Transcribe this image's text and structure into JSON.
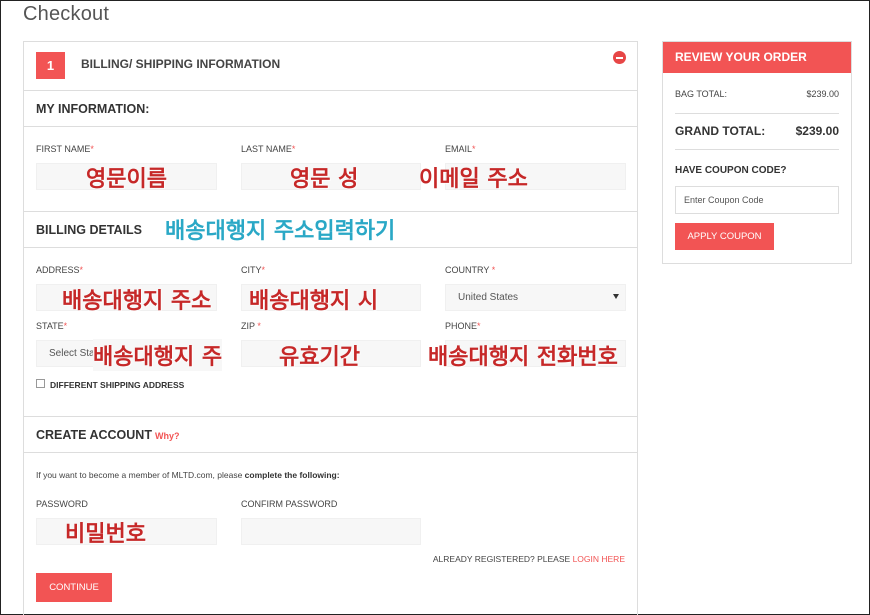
{
  "page": {
    "title": "Checkout"
  },
  "step": {
    "number": "1",
    "title": "BILLING/ SHIPPING INFORMATION"
  },
  "my_info": {
    "heading": "MY INFORMATION:",
    "first_name": {
      "label": "FIRST NAME",
      "req": "*",
      "annotation": "영문이름"
    },
    "last_name": {
      "label": "LAST NAME",
      "req": "*",
      "annotation": "영문 성"
    },
    "email": {
      "label": "EMAIL",
      "req": "*",
      "annotation": "이메일 주소"
    }
  },
  "billing": {
    "heading": "BILLING DETAILS",
    "heading_annotation": "배송대행지 주소입력하기",
    "address": {
      "label": "ADDRESS",
      "req": "*",
      "annotation": "배송대행지 주소"
    },
    "city": {
      "label": "CITY",
      "req": "*",
      "annotation": "배송대행지 시"
    },
    "country": {
      "label": "COUNTRY",
      "req": " *",
      "value": "United States"
    },
    "state": {
      "label": "STATE",
      "req": "*",
      "value": "Select State",
      "annotation": "배송대행지 주"
    },
    "zip": {
      "label": "ZIP",
      "req": " *",
      "annotation": "유효기간"
    },
    "phone": {
      "label": "PHONE",
      "req": "*",
      "annotation": "배송대행지 전화번호"
    },
    "different_shipping": "DIFFERENT SHIPPING ADDRESS"
  },
  "create_account": {
    "heading": "CREATE ACCOUNT",
    "why": "Why?",
    "info_prefix": "If you want to become a member of MLTD.com, please ",
    "info_bold": "complete the following:",
    "password": {
      "label": "PASSWORD",
      "annotation": "비밀번호"
    },
    "confirm_password": {
      "label": "CONFIRM PASSWORD"
    },
    "already_registered": "ALREADY REGISTERED? PLEASE ",
    "login_link": "LOGIN HERE",
    "continue_label": "CONTINUE"
  },
  "order": {
    "heading": "REVIEW YOUR ORDER",
    "bag_total_label": "BAG TOTAL:",
    "bag_total_value": "$239.00",
    "grand_total_label": "GRAND TOTAL:",
    "grand_total_value": "$239.00",
    "coupon_label": "HAVE COUPON CODE?",
    "coupon_placeholder": "Enter Coupon Code",
    "apply_label": "APPLY COUPON"
  },
  "colors": {
    "accent": "#f25454",
    "annotation_red": "#c62828",
    "annotation_blue": "#2aa8c6"
  }
}
